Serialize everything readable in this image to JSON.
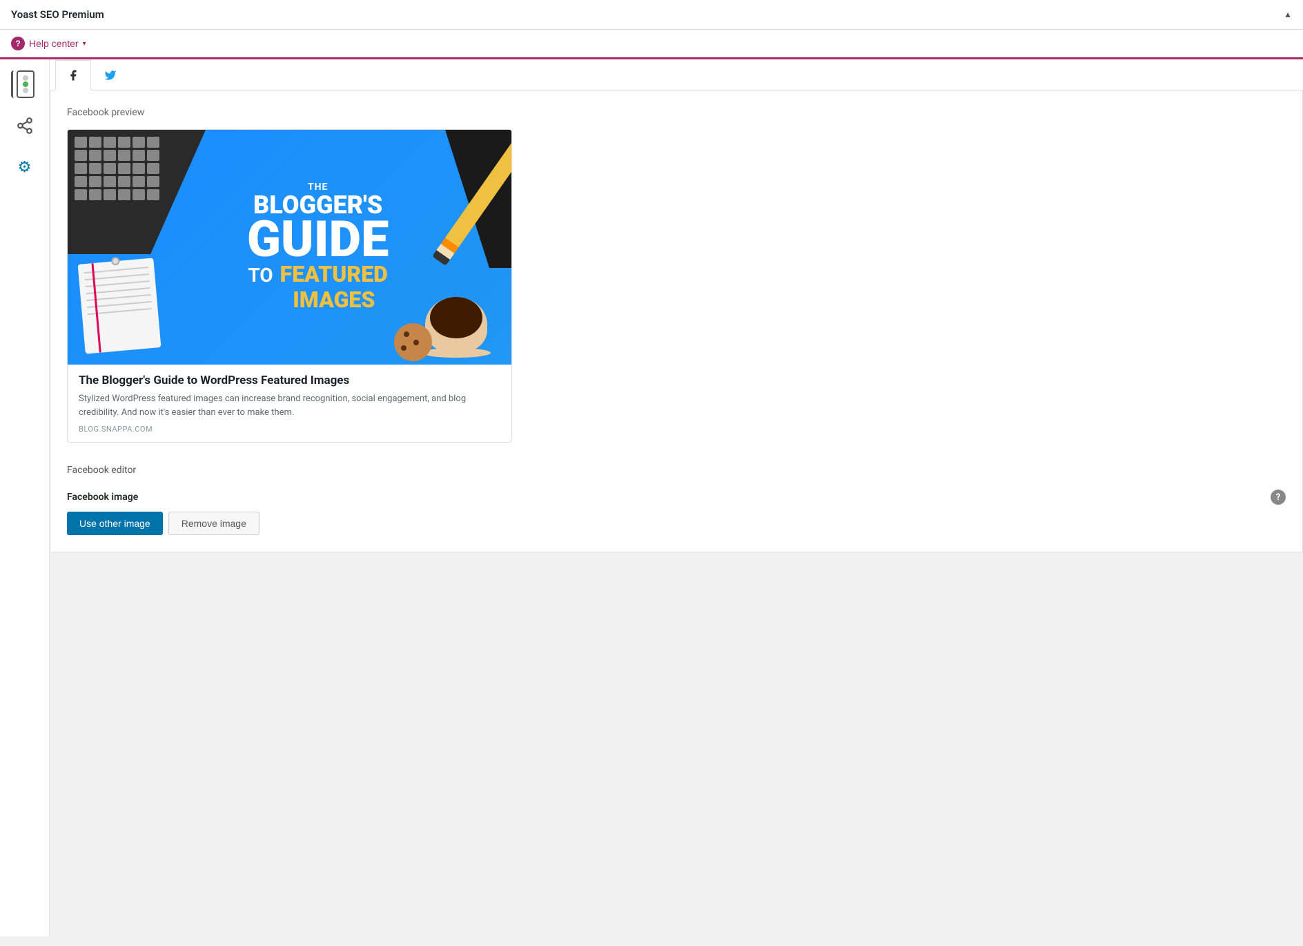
{
  "topbar": {
    "title": "Yoast SEO Premium",
    "arrow": "▲"
  },
  "helpbar": {
    "help_icon": "?",
    "label": "Help center",
    "chevron": "▾"
  },
  "sidebar": {
    "items": [
      {
        "id": "traffic-light",
        "label": "SEO analysis"
      },
      {
        "id": "share",
        "label": "Social"
      },
      {
        "id": "gear",
        "label": "Advanced"
      }
    ]
  },
  "tabs": [
    {
      "id": "facebook",
      "icon": "f",
      "label": "Facebook",
      "active": true
    },
    {
      "id": "twitter",
      "icon": "🐦",
      "label": "Twitter",
      "active": false
    }
  ],
  "facebook_preview": {
    "section_label": "Facebook preview",
    "image_alt": "The Blogger's Guide to WordPress Featured Images",
    "image_text": {
      "the": "THE",
      "bloggers": "BLOGGER'S",
      "guide": "GUIDE",
      "to": "TO",
      "featured": "FEATURED",
      "images": "IMAGES"
    },
    "card_title": "The Blogger's Guide to WordPress Featured Images",
    "card_desc": "Stylized WordPress featured images can increase brand recognition, social engagement, and blog credibility. And now it's easier than ever to make them.",
    "card_domain": "BLOG.SNAPPA.COM"
  },
  "facebook_editor": {
    "section_label": "Facebook editor",
    "image_field_label": "Facebook image",
    "use_other_image_btn": "Use other image",
    "remove_image_btn": "Remove image"
  },
  "colors": {
    "accent": "#a4286a",
    "link": "#0073aa",
    "primary_btn": "#0073aa"
  }
}
